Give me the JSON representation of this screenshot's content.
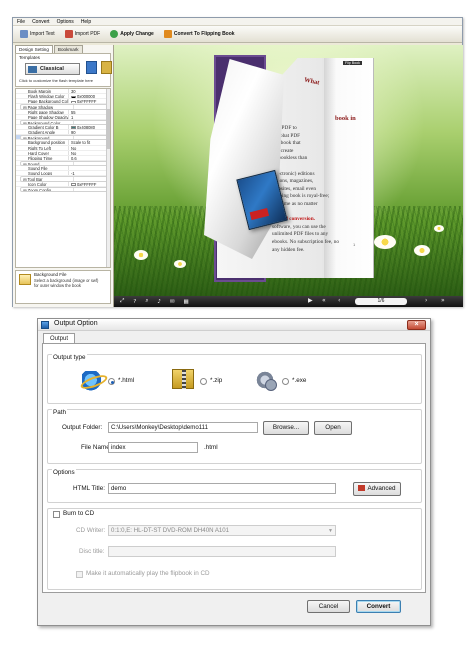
{
  "app": {
    "menu": [
      "File",
      "Convert",
      "Options",
      "Help"
    ],
    "toolbar": {
      "import_text": "Import Text",
      "import_pdf": "Import PDF",
      "apply_change": "Apply Change",
      "convert": "Convert To Flipping Book"
    },
    "panel": {
      "tabs": [
        "Design Setting",
        "Bookmark"
      ],
      "templates_label": "Templates",
      "template_selected": "Classical",
      "templates_tip": "Click to customize the flash template here",
      "properties": [
        {
          "name": "Book Margin",
          "value": "30"
        },
        {
          "name": "Flash Window Color",
          "value": "0x000000",
          "swatch": "#000000"
        },
        {
          "name": "Page Background Color",
          "value": "0xFFFFFF",
          "swatch": "#ffffff"
        },
        {
          "name": "Page Shadow",
          "value": "",
          "group": true
        },
        {
          "name": "Left page Shadow",
          "value": "90"
        },
        {
          "name": "Right page Shadow",
          "value": "55"
        },
        {
          "name": "Page Shadow Opacity",
          "value": "1"
        },
        {
          "name": "Background Config",
          "value": "",
          "group": true
        },
        {
          "name": "Background Color",
          "value": "",
          "group": true
        },
        {
          "name": "Gradient Color A",
          "value": "0xA3CFD1",
          "swatch": "#a3cfd1"
        },
        {
          "name": "Gradient Color B",
          "value": "0x408080",
          "swatch": "#408080"
        },
        {
          "name": "Gradient Angle",
          "value": "90"
        },
        {
          "name": "Background",
          "value": "",
          "group": true
        },
        {
          "name": "Background File",
          "value": "ahc11a.jpg",
          "selected": true
        },
        {
          "name": "Background position",
          "value": "Scale to fit"
        },
        {
          "name": "Right To Left",
          "value": "No"
        },
        {
          "name": "Hard Cover",
          "value": "No"
        },
        {
          "name": "Flipping Time",
          "value": "0.6"
        },
        {
          "name": "Sound",
          "value": "",
          "group": true
        },
        {
          "name": "Enable Sound",
          "value": "Enable"
        },
        {
          "name": "Sound File",
          "value": ""
        },
        {
          "name": "Sound Loops",
          "value": "-1"
        },
        {
          "name": "Tool Bar",
          "value": "",
          "group": true
        },
        {
          "name": "Tool bar",
          "value": "Show"
        },
        {
          "name": "Icon Color",
          "value": "0xFFFFFF",
          "swatch": "#ffffff"
        },
        {
          "name": "Zoom Config",
          "value": "",
          "group": true
        }
      ],
      "desc_title": "Background File",
      "desc_text": "Select a background (image or swf) for outer window the book"
    },
    "preview": {
      "heading": "What",
      "heading2": "book in",
      "right_tag": "Flip Book",
      "page_lines": [
        "The PDF to",
        "Acrobat PDF",
        "flip book that",
        "can create",
        "its bookless than",
        "",
        "(electronic) editions",
        "cations, magazines,",
        "websites, email even",
        "flipping book is royal-free;",
        "any time as no matter",
        "",
        "limited conversion.",
        "software, you can use the",
        "unlimited PDF files to any",
        "ebooks. No subscription fee, no",
        "any hidden fee."
      ],
      "page_no": "1",
      "page_indicator": "1/6"
    }
  },
  "dialog": {
    "title": "Output Option",
    "tab": "Output",
    "output_type": {
      "label": "Output type",
      "options": [
        "*.html",
        "*.zip",
        "*.exe"
      ],
      "selected": "*.html"
    },
    "path": {
      "label": "Path",
      "folder_label": "Output Folder:",
      "folder_value": "C:\\Users\\Monkey\\Desktop\\demo111",
      "browse": "Browse...",
      "open": "Open",
      "file_label": "File Name:",
      "file_value": "index",
      "file_ext": ".html"
    },
    "options": {
      "label": "Options",
      "html_title_label": "HTML Title:",
      "html_title_value": "demo",
      "advanced": "Advanced"
    },
    "burn": {
      "label": "Burn to CD",
      "writer_label": "CD Writer:",
      "writer_value": "0:1:0,E: HL-DT-ST DVD-ROM DH40N    A101",
      "disc_label": "Disc title:",
      "disc_value": "",
      "autoplay_label": "Make it automatically play the flipbook in CD"
    },
    "cancel": "Cancel",
    "convert": "Convert"
  }
}
